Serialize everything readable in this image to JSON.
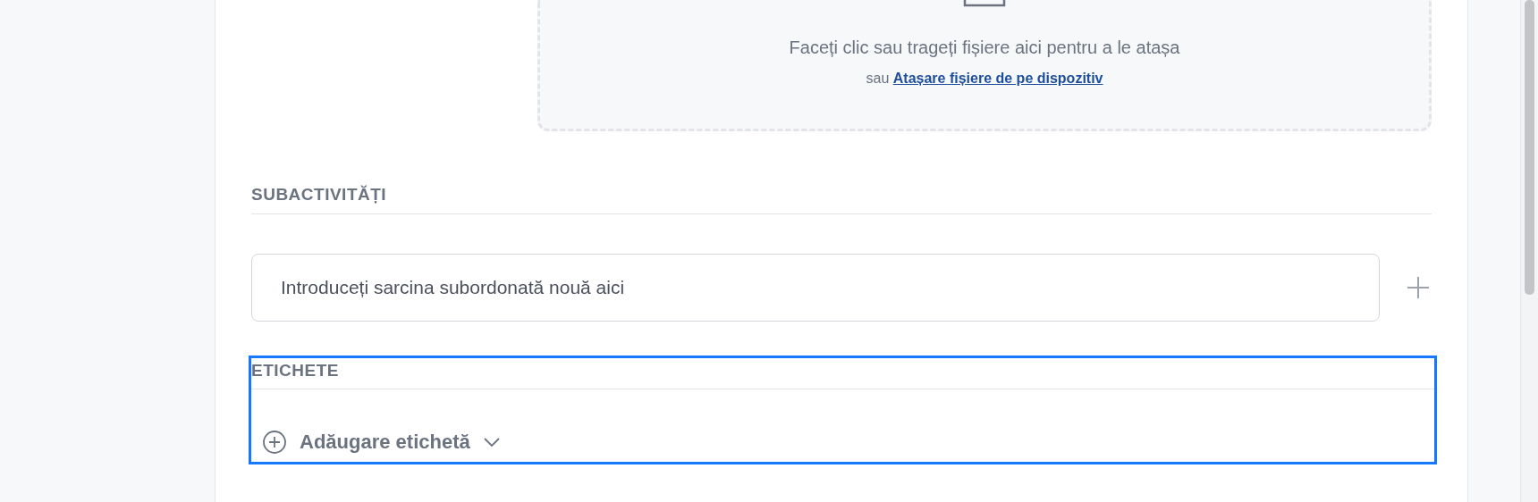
{
  "dropzone": {
    "instruction": "Faceți clic sau trageți fișiere aici pentru a le atașa",
    "alt_prefix": "sau",
    "alt_link": "Atașare fișiere de pe dispozitiv"
  },
  "subtasks": {
    "heading": "SUBACTIVITĂȚI",
    "placeholder": "Introduceți sarcina subordonată nouă aici"
  },
  "tags": {
    "heading": "ETICHETE",
    "focused": true,
    "add_label": "Adăugare etichetă"
  }
}
